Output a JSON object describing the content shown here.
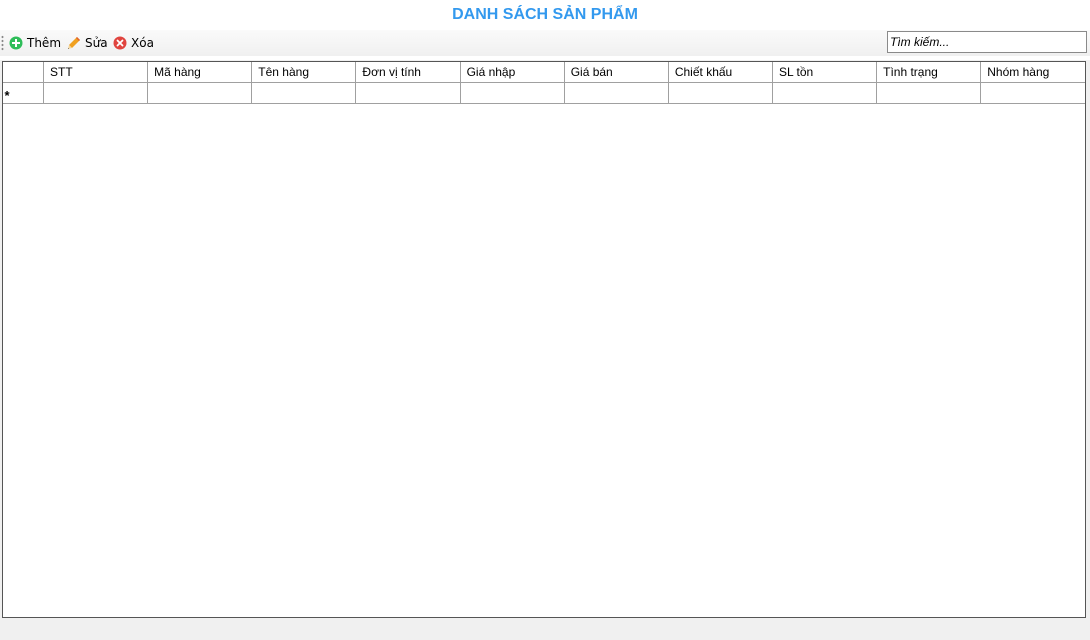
{
  "title": "DANH SÁCH SẢN PHẨM",
  "toolbar": {
    "add_label": "Thêm",
    "edit_label": "Sửa",
    "delete_label": "Xóa",
    "icons": {
      "add": "plus-circle-icon",
      "edit": "pencil-icon",
      "delete": "x-circle-icon"
    },
    "colors": {
      "add": "#2ebd59",
      "delete": "#e0443e",
      "title": "#3399ee"
    }
  },
  "search": {
    "placeholder": "Tìm kiếm..."
  },
  "grid": {
    "columns": [
      "STT",
      "Mã hàng",
      "Tên hàng",
      "Đơn vị tính",
      "Giá nhập",
      "Giá bán",
      "Chiết khấu",
      "SL tồn",
      "Tình trạng",
      "Nhóm hàng"
    ],
    "new_row_marker": "*"
  }
}
